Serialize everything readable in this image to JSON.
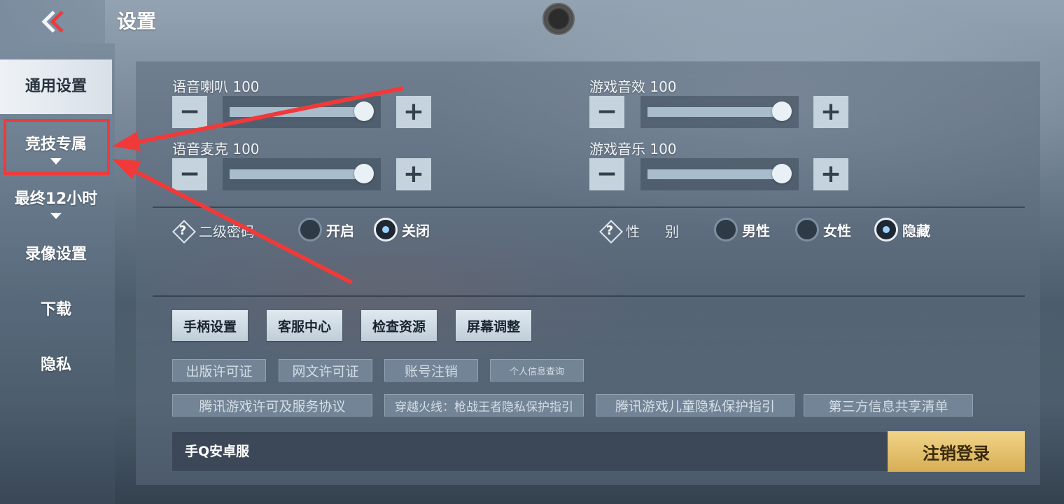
{
  "header": {
    "title": "设置",
    "back_icon": "double-chevron-left-icon"
  },
  "sidebar": {
    "items": [
      {
        "label": "通用设置",
        "active": true
      },
      {
        "label": "竞技专属",
        "has_caret": true
      },
      {
        "label": "最终12小时",
        "has_caret": true
      },
      {
        "label": "录像设置"
      },
      {
        "label": "下载"
      },
      {
        "label": "隐私"
      }
    ]
  },
  "audio": {
    "voice_speaker": {
      "name": "语音喇叭",
      "value": "100",
      "level": 1.0
    },
    "voice_mic": {
      "name": "语音麦克",
      "value": "100",
      "level": 1.0
    },
    "game_sfx": {
      "name": "游戏音效",
      "value": "100",
      "level": 1.0
    },
    "game_music": {
      "name": "游戏音乐",
      "value": "100",
      "level": 1.0
    },
    "minus_symbol": "−",
    "plus_symbol": "+"
  },
  "options": {
    "help_symbol": "?",
    "secondary_password": {
      "label": "二级密码",
      "choices": [
        {
          "label": "开启",
          "selected": false
        },
        {
          "label": "关闭",
          "selected": true
        }
      ]
    },
    "gender": {
      "label_a": "性",
      "label_b": "别",
      "choices": [
        {
          "label": "男性",
          "selected": false
        },
        {
          "label": "女性",
          "selected": false
        },
        {
          "label": "隐藏",
          "selected": true
        }
      ]
    }
  },
  "actions": [
    "手柄设置",
    "客服中心",
    "检查资源",
    "屏幕调整"
  ],
  "links_row1": [
    "出版许可证",
    "网文许可证",
    "账号注销",
    "个人信息查询"
  ],
  "links_row2": [
    "腾讯游戏许可及服务协议",
    "穿越火线：枪战王者隐私保护指引",
    "腾讯游戏儿童隐私保护指引",
    "第三方信息共享清单"
  ],
  "account": {
    "server": "手Q安卓服",
    "logout_label": "注销登录"
  },
  "colors": {
    "annotation": "#f03a3a",
    "logout_gold": "#e3c06a",
    "radio_selected": "#9ad0ff"
  }
}
